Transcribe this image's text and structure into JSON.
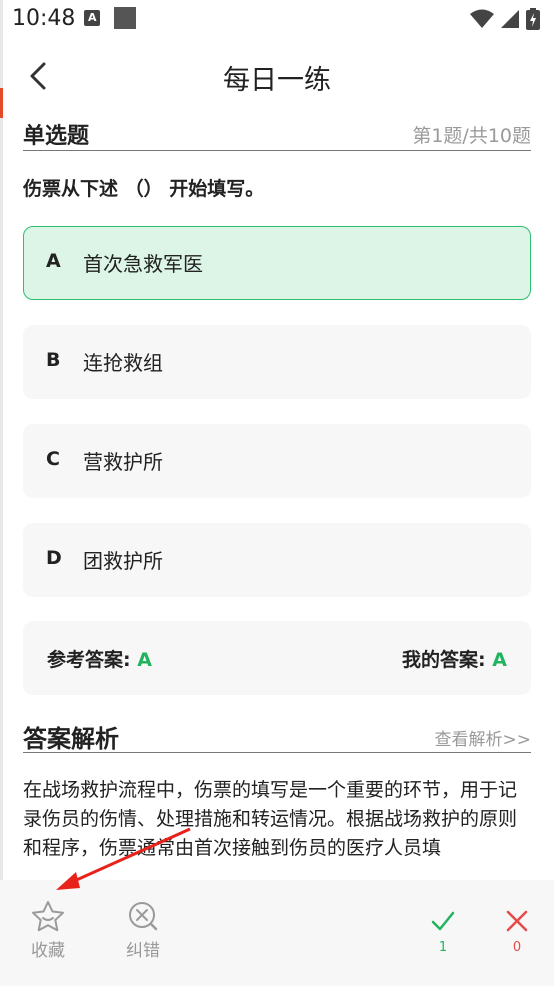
{
  "status_bar": {
    "time": "10:48",
    "notif_icon_label": "A"
  },
  "header": {
    "title": "每日一练"
  },
  "question": {
    "type": "单选题",
    "progress": "第1题/共10题",
    "text": "伤票从下述 （） 开始填写。",
    "options": [
      {
        "letter": "A",
        "text": "首次急救军医",
        "selected": true
      },
      {
        "letter": "B",
        "text": "连抢救组",
        "selected": false
      },
      {
        "letter": "C",
        "text": "营救护所",
        "selected": false
      },
      {
        "letter": "D",
        "text": "团救护所",
        "selected": false
      }
    ]
  },
  "answer": {
    "ref_label": "参考答案:",
    "ref_value": "A",
    "mine_label": "我的答案:",
    "mine_value": "A"
  },
  "analysis": {
    "title": "答案解析",
    "link": "查看解析>>",
    "text": "在战场救护流程中，伤票的填写是一个重要的环节，用于记录伤员的伤情、处理措施和转运情况。根据战场救护的原则和程序，伤票通常由首次接触到伤员的医疗人员填"
  },
  "bottom_bar": {
    "favorite_label": "收藏",
    "correct_error_label": "纠错",
    "correct_count": "1",
    "wrong_count": "0"
  },
  "colors": {
    "accent_green": "#22b35e",
    "selected_bg": "#dcf5e6",
    "wrong_red": "#e84a4a",
    "annotation_red": "#e8221b"
  }
}
